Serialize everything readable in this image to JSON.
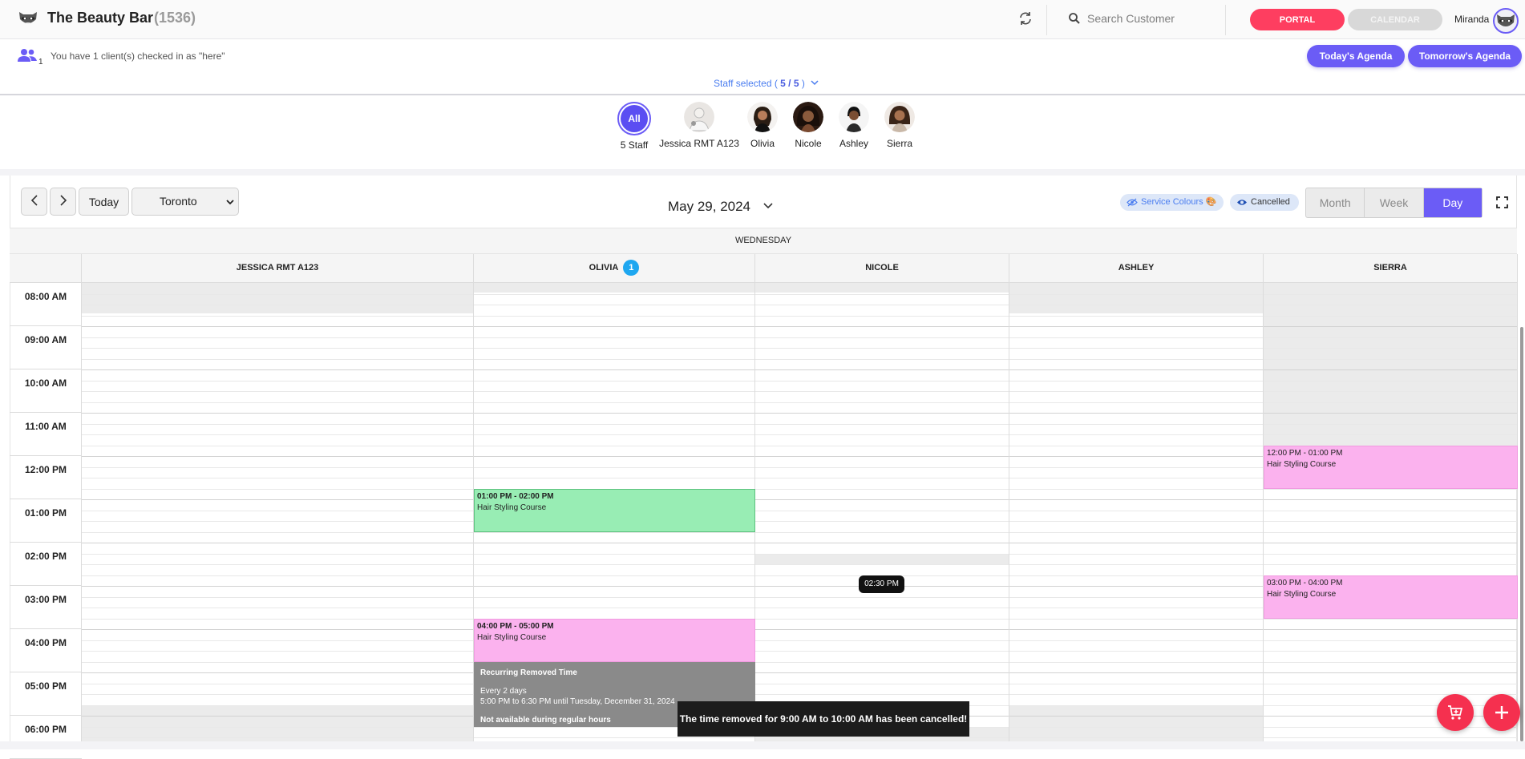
{
  "header": {
    "app_title": "The Beauty Bar",
    "app_count": "(1536)",
    "search_placeholder": "Search Customer",
    "portal_label": "PORTAL",
    "calendar_label": "CALENDAR",
    "user_name": "Miranda"
  },
  "info": {
    "checkin_count": "1",
    "checkin_text": "You have 1 client(s) checked in as \"here\"",
    "todays_agenda": "Today's Agenda",
    "tomorrows_agenda": "Tomorrow's Agenda",
    "staff_selected_prefix": "Staff selected (",
    "staff_selected_value": " 5 / 5 ",
    "staff_selected_suffix": ")"
  },
  "staff": {
    "all_label": "All",
    "all_caption": "5 Staff",
    "members": [
      "Jessica RMT A123",
      "Olivia",
      "Nicole",
      "Ashley",
      "Sierra"
    ]
  },
  "toolbar": {
    "today_label": "Today",
    "timezone": "Toronto",
    "date_title": "May 29, 2024",
    "service_colours_label": "Service Colours 🎨",
    "cancelled_label": "Cancelled",
    "views": [
      "Month",
      "Week",
      "Day"
    ],
    "active_view": "Day"
  },
  "grid": {
    "day_label": "WEDNESDAY",
    "columns": [
      {
        "name": "JESSICA RMT A123",
        "badge": ""
      },
      {
        "name": "OLIVIA",
        "badge": "1"
      },
      {
        "name": "NICOLE",
        "badge": ""
      },
      {
        "name": "ASHLEY",
        "badge": ""
      },
      {
        "name": "SIERRA",
        "badge": ""
      }
    ],
    "times": [
      "08:00 AM",
      "09:00 AM",
      "10:00 AM",
      "11:00 AM",
      "12:00 PM",
      "01:00 PM",
      "02:00 PM",
      "03:00 PM",
      "04:00 PM",
      "05:00 PM",
      "06:00 PM"
    ]
  },
  "events": {
    "olivia_1": {
      "time": "01:00 PM - 02:00 PM",
      "title": "Hair Styling Course",
      "color": "#98edb4"
    },
    "olivia_2": {
      "time": "04:00 PM - 05:00 PM",
      "title": "Hair Styling Course",
      "color": "#fbb2ee"
    },
    "sierra_1": {
      "time": "12:00 PM - 01:00 PM",
      "title": "Hair Styling Course",
      "color": "#fbb2ee"
    },
    "sierra_2": {
      "time": "03:00 PM - 04:00 PM",
      "title": "Hair Styling Course",
      "color": "#fbb2ee"
    },
    "removed": {
      "title": "Recurring Removed Time",
      "line1": "Every 2 days",
      "line2": "5:00 PM to 6:30 PM until Tuesday, December 31, 2024",
      "line3": "Not available during regular hours"
    }
  },
  "now_indicator": "02:30 PM",
  "toast": "The time removed for 9:00 AM to 10:00 AM has been cancelled!",
  "colors": {
    "accent": "#6b5cf6",
    "portal": "#fe3e60",
    "badge": "#1ea7f0"
  }
}
